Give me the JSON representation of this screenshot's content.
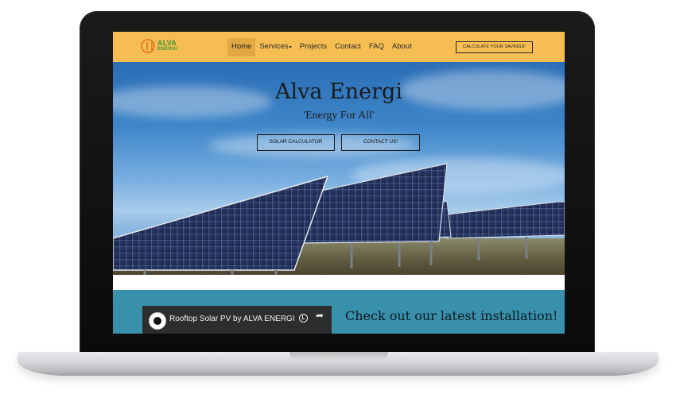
{
  "brand": {
    "logo_line1": "ALVA",
    "logo_line2": "ENERGI",
    "primary_color": "#f5bd52",
    "secondary_color": "#3890ab"
  },
  "nav": {
    "items": [
      {
        "label": "Home",
        "active": true
      },
      {
        "label": "Services",
        "dropdown": true
      },
      {
        "label": "Projects"
      },
      {
        "label": "Contact"
      },
      {
        "label": "FAQ"
      },
      {
        "label": "About"
      }
    ],
    "caret": "▾",
    "cta_label": "CALCULATE YOUR SAVINGS!"
  },
  "hero": {
    "title": "Alva Energi",
    "subtitle": "'Energy For All'",
    "buttons": [
      {
        "label": "SOLAR CALCULATOR"
      },
      {
        "label": "CONTACT US!"
      }
    ]
  },
  "install_section": {
    "video_title": "Rooftop Solar PV by ALVA ENERGI",
    "heading": "Check out our latest installation!",
    "share_icon": "➦"
  }
}
